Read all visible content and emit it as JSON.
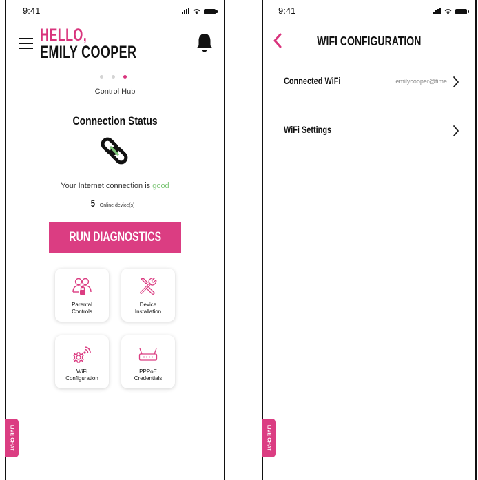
{
  "accent_color": "#db3d82",
  "good_color": "#7cc576",
  "screen_home": {
    "status_time": "9:41",
    "greeting_line1": "HELLO,",
    "greeting_line2": "EMILY COOPER",
    "pager": {
      "count": 3,
      "active_index": 2
    },
    "carousel_label": "Control Hub",
    "connection_title": "Connection Status",
    "connection_text_prefix": "Your Internet connection is ",
    "connection_state": "good",
    "devices_count": "5",
    "devices_label": "Online device(s)",
    "run_button": "RUN DIAGNOSTICS",
    "tiles": [
      {
        "icon": "parental-controls-icon",
        "line1": "Parental",
        "line2": "Controls"
      },
      {
        "icon": "tools-icon",
        "line1": "Device",
        "line2": "Installation"
      },
      {
        "icon": "wifi-gear-icon",
        "line1": "WiFi",
        "line2": "Configuration"
      },
      {
        "icon": "router-icon",
        "line1": "PPPoE",
        "line2": "Credentials"
      }
    ],
    "live_chat": "LIVE CHAT"
  },
  "screen_wifi": {
    "status_time": "9:41",
    "title": "WIFI CONFIGURATION",
    "rows": [
      {
        "label": "Connected WiFi",
        "value": "emilycooper@time"
      },
      {
        "label": "WiFi Settings",
        "value": ""
      }
    ],
    "live_chat": "LIVE CHAT"
  }
}
